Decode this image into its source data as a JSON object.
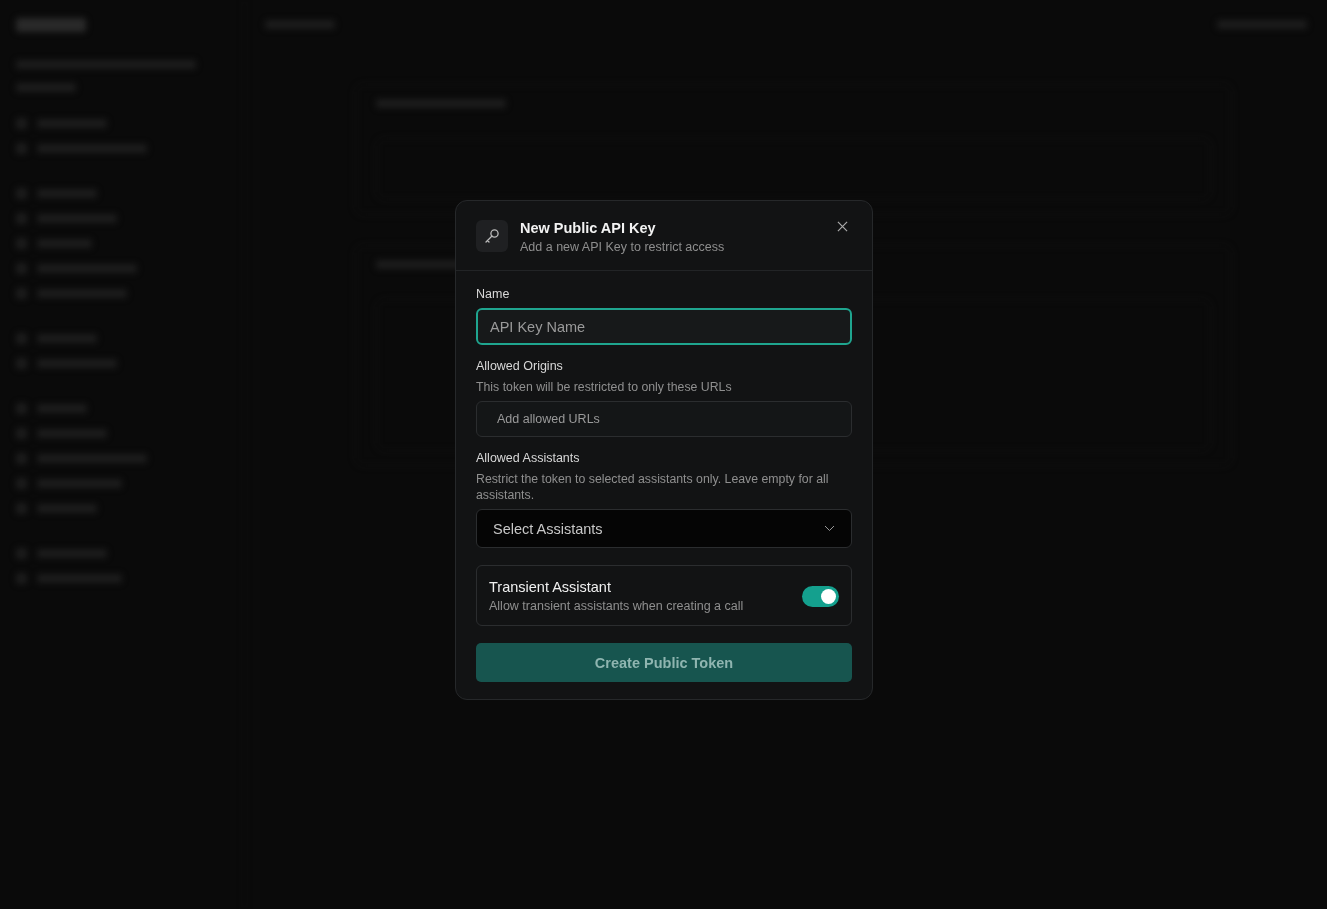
{
  "dialog": {
    "title": "New Public API Key",
    "subtitle": "Add a new API Key to restrict access",
    "fields": [
      {
        "kind": "input",
        "label": "Name",
        "placeholder": "API Key Name",
        "focused": true
      },
      {
        "kind": "input",
        "label": "Allowed Origins",
        "hint": "This token will be restricted to only these URLs",
        "placeholder": "Add allowed URLs",
        "focused": false
      },
      {
        "kind": "select",
        "label": "Allowed Assistants",
        "hint": "Restrict the token to selected assistants only. Leave empty for all assistants.",
        "placeholder": "Select Assistants",
        "focused": false
      }
    ],
    "toggle": {
      "title": "Transient Assistant",
      "description": "Allow transient assistants when creating a call",
      "on": true
    },
    "submit": "Create Public Token"
  }
}
